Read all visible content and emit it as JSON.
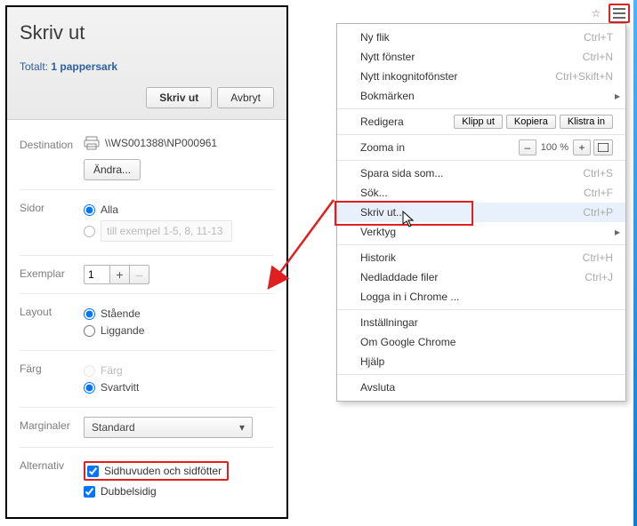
{
  "toolbar": {
    "star": "☆",
    "menu": "≡"
  },
  "print": {
    "title": "Skriv ut",
    "total_prefix": "Totalt: ",
    "total_value": "1 pappersark",
    "buttons": {
      "print": "Skriv ut",
      "cancel": "Avbryt"
    },
    "destination": {
      "label": "Destination",
      "value": "\\\\WS001388\\NP000961",
      "change": "Ändra..."
    },
    "pages": {
      "label": "Sidor",
      "all": "Alla",
      "custom_placeholder": "till exempel 1-5, 8, 11-13"
    },
    "copies": {
      "label": "Exemplar",
      "value": "1"
    },
    "layout": {
      "label": "Layout",
      "portrait": "Stående",
      "landscape": "Liggande"
    },
    "color": {
      "label": "Färg",
      "color": "Färg",
      "bw": "Svartvitt"
    },
    "margins": {
      "label": "Marginaler",
      "value": "Standard"
    },
    "options": {
      "label": "Alternativ",
      "headers": "Sidhuvuden och sidfötter",
      "duplex": "Dubbelsidig"
    }
  },
  "menu": {
    "new_tab": {
      "label": "Ny flik",
      "shortcut": "Ctrl+T"
    },
    "new_window": {
      "label": "Nytt fönster",
      "shortcut": "Ctrl+N"
    },
    "new_incognito": {
      "label": "Nytt inkognitofönster",
      "shortcut": "Ctrl+Skift+N"
    },
    "bookmarks": {
      "label": "Bokmärken"
    },
    "edit": {
      "label": "Redigera",
      "cut": "Klipp ut",
      "copy": "Kopiera",
      "paste": "Klistra in"
    },
    "zoom": {
      "label": "Zooma in",
      "value": "100 %"
    },
    "save_as": {
      "label": "Spara sida som...",
      "shortcut": "Ctrl+S"
    },
    "find": {
      "label": "Sök...",
      "shortcut": "Ctrl+F"
    },
    "print": {
      "label": "Skriv ut...",
      "shortcut": "Ctrl+P"
    },
    "tools": {
      "label": "Verktyg"
    },
    "history": {
      "label": "Historik",
      "shortcut": "Ctrl+H"
    },
    "downloads": {
      "label": "Nedladdade filer",
      "shortcut": "Ctrl+J"
    },
    "signin": {
      "label": "Logga in i Chrome ..."
    },
    "settings": {
      "label": "Inställningar"
    },
    "about": {
      "label": "Om Google Chrome"
    },
    "help": {
      "label": "Hjälp"
    },
    "exit": {
      "label": "Avsluta"
    }
  }
}
